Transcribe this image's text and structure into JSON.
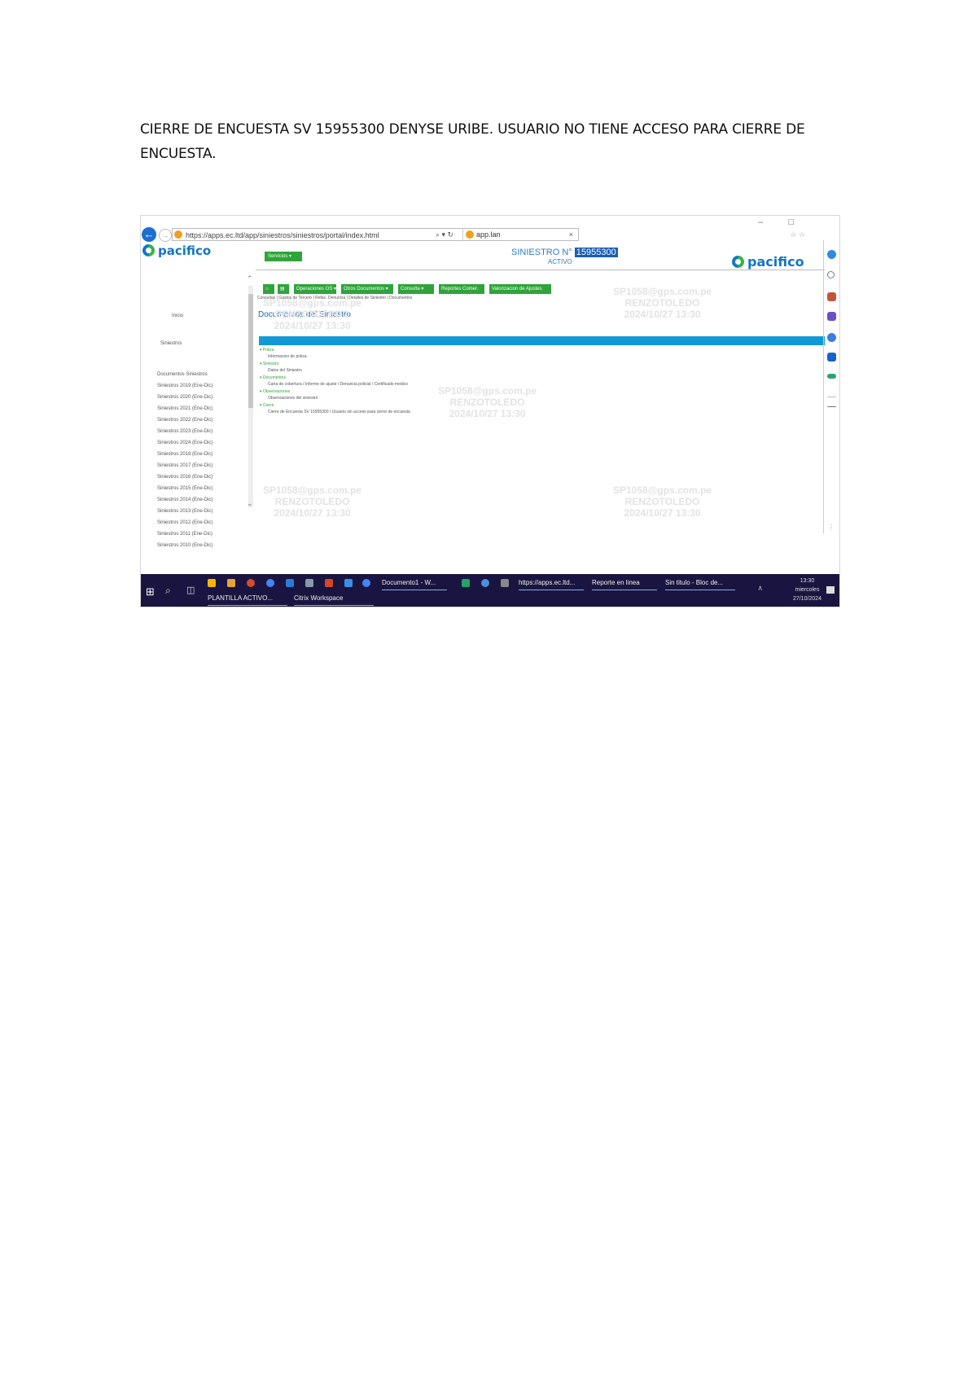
{
  "document": {
    "paragraph": "CIERRE DE ENCUESTA SV 15955300    DENYSE URIBE. USUARIO NO TIENE ACCESO PARA CIERRE DE ENCUESTA."
  },
  "browser": {
    "url": "https://apps.ec.ltd/app/siniestros/siniestros/portal/index.html",
    "url_controls": "⌕ ▾ ↻",
    "tab_title": "app.lan",
    "close_glyph": "×",
    "window_controls": "– □",
    "window_controls_sub": "☆ ☆"
  },
  "app": {
    "brand": "pacifico",
    "menu_label": "Servicios ▾",
    "siniestro_label": "SINIESTRO N°",
    "siniestro_number": "15955300",
    "status": "ACTIVO",
    "section_title": "Documentos del Siniestro",
    "subtabs": "Consultas | Gastos de Tercero | Refac. Denuncia | Detalles de Siniestro | Documentos",
    "toolbar": [
      {
        "label": "⌂",
        "color": "#2ea43a"
      },
      {
        "label": "▤",
        "color": "#2ea43a"
      },
      {
        "label": "Operaciones OS ▾",
        "color": "#2ea43a"
      },
      {
        "label": "Otros Documentos ▾",
        "color": "#2ea43a"
      },
      {
        "label": "Consulta ▾",
        "color": "#2ea43a"
      },
      {
        "label": "Reportes Comer.",
        "color": "#2ea43a"
      },
      {
        "label": "Valorizacion de Ajustes",
        "color": "#2ea43a"
      }
    ],
    "sidebar": {
      "items": [
        "Inicio",
        "Siniestros",
        "Documentos Siniestros",
        "Siniestros 2019 (Ene-Dic)",
        "Siniestros 2020 (Ene-Dic)",
        "Siniestros 2021 (Ene-Dic)",
        "Siniestros 2022 (Ene-Dic)",
        "Siniestros 2023 (Ene-Dic)",
        "Siniestros 2024 (Ene-Dic)",
        "Siniestros 2018 (Ene-Dic)",
        "Siniestros 2017 (Ene-Dic)",
        "Siniestros 2016 (Ene-Dic)",
        "Siniestros 2015 (Ene-Dic)",
        "Siniestros 2014 (Ene-Dic)",
        "Siniestros 2013 (Ene-Dic)",
        "Siniestros 2012 (Ene-Dic)",
        "Siniestros 2011 (Ene-Dic)",
        "Siniestros 2010 (Ene-Dic)"
      ]
    },
    "tree": [
      {
        "text": "▾ Poliza",
        "kind": "head"
      },
      {
        "text": "Informacion de poliza",
        "kind": "child"
      },
      {
        "text": "▾ Siniestro",
        "kind": "head"
      },
      {
        "text": "Datos del Siniestro",
        "kind": "child"
      },
      {
        "text": "▾ Documentos",
        "kind": "head"
      },
      {
        "text": "Carta de cobertura / Informe de ajuste / Denuncia policial / Certificado medico",
        "kind": "child"
      },
      {
        "text": "▾ Observaciones",
        "kind": "head"
      },
      {
        "text": "Observaciones del siniestro",
        "kind": "child"
      },
      {
        "text": "▾ Cierre",
        "kind": "head"
      },
      {
        "text": "Cierre de Encuesta SV 15955300 / Usuario sin acceso para cierre de encuesta",
        "kind": "child"
      }
    ],
    "watermarks": [
      "SP1058@gps.com.pe\nRENZOTOLEDO\n2024/10/27 13:30",
      "SP1058@gps.com.pe\nRENZOTOLEDO\n2024/10/27 13:30",
      "SP1058@gps.com.pe\nRENZOTOLEDO\n2024/10/27 13:30",
      "SP1058@gps.com.pe\nRENZOTOLEDO\n2024/10/27 13:30",
      "SP1058@gps.com.pe\nRENZOTOLEDO\n2024/10/27 13:30"
    ]
  },
  "taskbar": {
    "start": "⊞",
    "search": "⌕",
    "task_view": "◫",
    "apps_row1": [
      "Documento1 - W...",
      "https://apps.ec.ltd...",
      "Reporte en linea",
      "Sin titulo - Bloc de..."
    ],
    "apps_row2": [
      "PLANTILLA ACTIVO...",
      "Citrix Workspace"
    ],
    "chevron": "∧",
    "clock_time": "13:30",
    "clock_day": "miercoles",
    "clock_date": "27/10/2024",
    "pin_colors": [
      "#f2b705",
      "#e8a23a",
      "#d94c2b",
      "#4285f4",
      "#2b7bd6",
      "#d24726",
      "#3a8ee6",
      "#1e88e5",
      "#21a366",
      "#4a90e2",
      "#888888"
    ]
  }
}
